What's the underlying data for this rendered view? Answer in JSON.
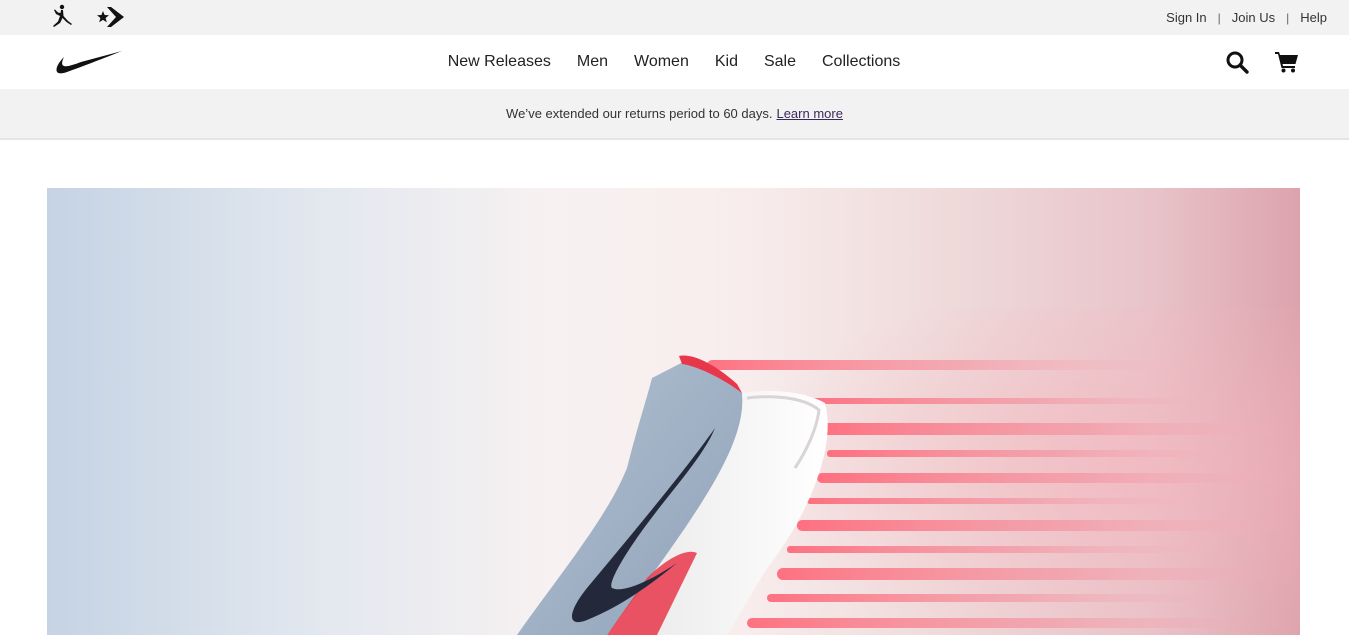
{
  "utility_bar": {
    "brand_icons": [
      "jordan-jumpman-icon",
      "converse-icon"
    ],
    "links": [
      {
        "label": "Sign In"
      },
      {
        "label": "Join Us"
      },
      {
        "label": "Help"
      }
    ],
    "separator": "|"
  },
  "header": {
    "logo_icon": "nike-swoosh-icon",
    "nav": [
      {
        "label": "New Releases"
      },
      {
        "label": "Men"
      },
      {
        "label": "Women"
      },
      {
        "label": "Kid"
      },
      {
        "label": "Sale"
      },
      {
        "label": "Collections"
      }
    ],
    "icons": [
      "search-icon",
      "cart-icon"
    ]
  },
  "promo": {
    "text": "We’ve extended our returns period to 60 days.",
    "link_label": "Learn more"
  },
  "hero": {
    "image": "running-shoe-hero-image"
  },
  "colors": {
    "utility_bg": "#f2f2f2",
    "promo_link": "#3a2a5a",
    "accent_red": "#e8374a",
    "shoe_grey": "#9fb1c7",
    "swoosh_dark": "#23293a"
  }
}
